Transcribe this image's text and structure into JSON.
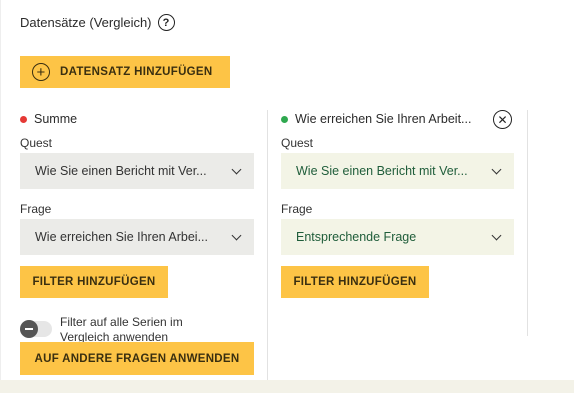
{
  "title": "Datensätze (Vergleich)",
  "help_glyph": "?",
  "add_dataset": {
    "icon": "plus-circle-icon",
    "glyph": "+",
    "label": "DATENSATZ HINZUFÜGEN"
  },
  "series": [
    {
      "name": "Summe",
      "color": "#e53935",
      "quest_label": "Quest",
      "quest_value": "Wie Sie einen Bericht mit Ver...",
      "frage_label": "Frage",
      "frage_value": "Wie erreichen Sie Ihren Arbei...",
      "filter_button": "FILTER HINZUFÜGEN"
    },
    {
      "name": "Wie erreichen Sie Ihren Arbeit...",
      "color": "#2fa84f",
      "quest_label": "Quest",
      "quest_value": "Wie Sie einen Bericht mit Ver...",
      "frage_label": "Frage",
      "frage_value": "Entsprechende Frage",
      "filter_button": "FILTER HINZUFÜGEN",
      "close_glyph": "✕"
    }
  ],
  "toggle": {
    "label": "Filter auf alle Serien im Vergleich anwenden",
    "on": false
  },
  "apply_button": "AUF ANDERE FRAGEN ANWENDEN",
  "colors": {
    "accent_yellow": "#fdc446",
    "select_gray": "#ebebe8",
    "select_cream": "#f3f4e6",
    "footer": "#f3f2e8"
  }
}
